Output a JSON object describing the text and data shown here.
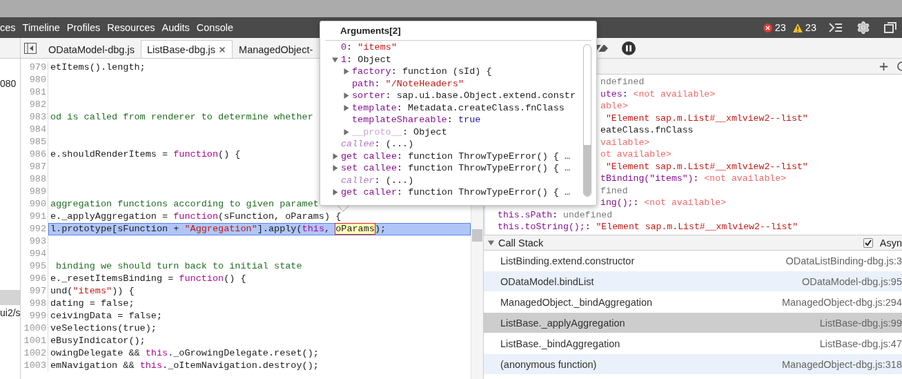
{
  "top_toolbar": {
    "tabs": [
      {
        "label": "ces"
      },
      {
        "label": "Timeline"
      },
      {
        "label": "Profiles"
      },
      {
        "label": "Resources"
      },
      {
        "label": "Audits"
      },
      {
        "label": "Console"
      }
    ],
    "error_count": "23",
    "warning_count": "23"
  },
  "navigator": {
    "items": [
      {
        "label": "080",
        "selected": false
      },
      {
        "selected": true
      },
      {
        "label": "ui2/s",
        "selected": false
      }
    ]
  },
  "editor": {
    "tabs": [
      {
        "label": "ODataModel-dbg.js",
        "selected": false
      },
      {
        "label": "ListBase-dbg.js",
        "selected": true
      },
      {
        "label": "ManagedObject-",
        "selected": false
      }
    ],
    "lines": [
      {
        "number": "979",
        "selected": false,
        "segments": [
          {
            "text": "etItems().length;",
            "kind": "plain"
          }
        ]
      },
      {
        "number": "980",
        "selected": false
      },
      {
        "number": "981",
        "selected": false
      },
      {
        "number": "982",
        "selected": false
      },
      {
        "number": "983",
        "selected": false,
        "segments": [
          {
            "text": "od is called from renderer to determine whether",
            "kind": "comment"
          }
        ]
      },
      {
        "number": "984",
        "selected": false
      },
      {
        "number": "985",
        "selected": false
      },
      {
        "number": "986",
        "selected": false,
        "segments": [
          {
            "text": "e.shouldRenderItems = ",
            "kind": "plain"
          },
          {
            "text": "function",
            "kind": "keyword"
          },
          {
            "text": "() {",
            "kind": "plain"
          }
        ]
      },
      {
        "number": "987",
        "selected": false
      },
      {
        "number": "988",
        "selected": false
      },
      {
        "number": "989",
        "selected": false
      },
      {
        "number": "990",
        "selected": false,
        "segments": [
          {
            "text": "aggregation functions according to given paramet",
            "kind": "comment"
          }
        ]
      },
      {
        "number": "991",
        "selected": false,
        "segments": [
          {
            "text": "e._applyAggregation = ",
            "kind": "plain"
          },
          {
            "text": "function",
            "kind": "keyword"
          },
          {
            "text": "(sFunction, oParams) {",
            "kind": "plain"
          }
        ]
      },
      {
        "number": "992",
        "selected": true,
        "segments": [
          {
            "text": "l.prototype[sFunction + ",
            "kind": "plain"
          },
          {
            "text": "\"Aggregation\"",
            "kind": "string"
          },
          {
            "text": "].apply(",
            "kind": "plain"
          },
          {
            "text": "this",
            "kind": "keyword"
          },
          {
            "text": ", ",
            "kind": "plain"
          },
          {
            "text": "oParams",
            "kind": "highlight"
          },
          {
            "text": ");",
            "kind": "plain"
          }
        ]
      },
      {
        "number": "993",
        "selected": false
      },
      {
        "number": "994",
        "selected": false
      },
      {
        "number": "995",
        "selected": false,
        "segments": [
          {
            "text": " binding we should turn back to initial state",
            "kind": "comment"
          }
        ]
      },
      {
        "number": "996",
        "selected": false,
        "segments": [
          {
            "text": "e._resetItemsBinding = ",
            "kind": "plain"
          },
          {
            "text": "function",
            "kind": "keyword"
          },
          {
            "text": "() {",
            "kind": "plain"
          }
        ]
      },
      {
        "number": "997",
        "selected": false,
        "segments": [
          {
            "text": "und(",
            "kind": "plain"
          },
          {
            "text": "\"items\"",
            "kind": "string"
          },
          {
            "text": ")) {",
            "kind": "plain"
          }
        ]
      },
      {
        "number": "998",
        "selected": false,
        "segments": [
          {
            "text": "dating = false;",
            "kind": "plain"
          }
        ]
      },
      {
        "number": "999",
        "selected": false,
        "segments": [
          {
            "text": "ceivingData = false;",
            "kind": "plain"
          }
        ]
      },
      {
        "number": "1000",
        "selected": false,
        "segments": [
          {
            "text": "veSelections(true);",
            "kind": "plain"
          }
        ]
      },
      {
        "number": "1001",
        "selected": false,
        "segments": [
          {
            "text": "eBusyIndicator();",
            "kind": "plain"
          }
        ]
      },
      {
        "number": "1002",
        "selected": false,
        "segments": [
          {
            "text": "owingDelegate && ",
            "kind": "plain"
          },
          {
            "text": "this",
            "kind": "keyword"
          },
          {
            "text": "._oGrowingDelegate.reset();",
            "kind": "plain"
          }
        ]
      },
      {
        "number": "1003",
        "selected": false,
        "segments": [
          {
            "text": "emNavigation && ",
            "kind": "plain"
          },
          {
            "text": "this",
            "kind": "keyword"
          },
          {
            "text": "._oItemNavigation.destroy();",
            "kind": "plain"
          }
        ]
      }
    ]
  },
  "arguments_popover": {
    "title": "Arguments[2]",
    "nodes": [
      {
        "parts": [
          {
            "text": "0",
            "kind": "key"
          },
          {
            "text": ": ",
            "kind": "plain"
          },
          {
            "text": "\"items\"",
            "kind": "string"
          }
        ]
      },
      {
        "expanded": true,
        "parts": [
          {
            "text": "1",
            "kind": "key"
          },
          {
            "text": ": Object",
            "kind": "plain"
          }
        ],
        "children": [
          {
            "expanded": false,
            "parts": [
              {
                "text": "factory",
                "kind": "key"
              },
              {
                "text": ": function (sId) {",
                "kind": "plain"
              }
            ]
          },
          {
            "parts": [
              {
                "text": "path",
                "kind": "key"
              },
              {
                "text": ": ",
                "kind": "plain"
              },
              {
                "text": "\"/NoteHeaders\"",
                "kind": "string"
              }
            ]
          },
          {
            "expanded": false,
            "parts": [
              {
                "text": "sorter",
                "kind": "key"
              },
              {
                "text": ": sap.ui.base.Object.extend.constr",
                "kind": "plain"
              }
            ]
          },
          {
            "expanded": false,
            "parts": [
              {
                "text": "template",
                "kind": "key"
              },
              {
                "text": ": Metadata.createClass.fnClass",
                "kind": "plain"
              }
            ]
          },
          {
            "parts": [
              {
                "text": "templateShareable",
                "kind": "key"
              },
              {
                "text": ": ",
                "kind": "plain"
              },
              {
                "text": "true",
                "kind": "bool"
              }
            ]
          },
          {
            "expanded": false,
            "parts": [
              {
                "text": "__proto__",
                "kind": "faded"
              },
              {
                "text": ": Object",
                "kind": "plain"
              }
            ]
          }
        ]
      },
      {
        "parts": [
          {
            "text": "callee",
            "kind": "lazy"
          },
          {
            "text": ": (...)",
            "kind": "plain"
          }
        ]
      },
      {
        "expanded": false,
        "parts": [
          {
            "text": "get callee",
            "kind": "key"
          },
          {
            "text": ": function ThrowTypeError() { …",
            "kind": "plain"
          }
        ]
      },
      {
        "expanded": false,
        "parts": [
          {
            "text": "set callee",
            "kind": "key"
          },
          {
            "text": ": function ThrowTypeError() { …",
            "kind": "plain"
          }
        ]
      },
      {
        "parts": [
          {
            "text": "caller",
            "kind": "lazy"
          },
          {
            "text": ": (...)",
            "kind": "plain"
          }
        ]
      },
      {
        "expanded": false,
        "parts": [
          {
            "text": "get caller",
            "kind": "key"
          },
          {
            "text": ": function ThrowTypeError() { …",
            "kind": "plain"
          }
        ]
      }
    ]
  },
  "watch": {
    "rows": [
      {
        "kind": "partial",
        "segments": [
          {
            "text": "ndefined",
            "kind": "undef"
          }
        ]
      },
      {
        "kind": "partial",
        "segments": [
          {
            "text": "utes",
            "kind": "name"
          },
          {
            "text": ": ",
            "kind": "plain"
          },
          {
            "text": "<not available>",
            "kind": "na"
          }
        ]
      },
      {
        "kind": "partial",
        "segments": [
          {
            "text": "able>",
            "kind": "na"
          }
        ]
      },
      {
        "kind": "partial",
        "segments": [
          {
            "text": " \"Element sap.m.List#__xmlview2--list\"",
            "kind": "string"
          }
        ]
      },
      {
        "kind": "partial",
        "segments": [
          {
            "text": "eateClass.fnClass",
            "kind": "plain"
          }
        ]
      },
      {
        "kind": "partial",
        "segments": [
          {
            "text": "vailable>",
            "kind": "na"
          }
        ]
      },
      {
        "kind": "partial",
        "segments": [
          {
            "text": "ot available>",
            "kind": "na"
          }
        ]
      },
      {
        "kind": "partial",
        "segments": [
          {
            "text": " \"Element sap.m.List#__xmlview2--list\"",
            "kind": "string"
          }
        ]
      },
      {
        "kind": "partial",
        "segments": [
          {
            "text": "tBinding(\"items\")",
            "kind": "name"
          },
          {
            "text": ": ",
            "kind": "plain"
          },
          {
            "text": "<not available>",
            "kind": "na"
          }
        ]
      },
      {
        "kind": "partial",
        "segments": [
          {
            "text": "fined",
            "kind": "undef"
          }
        ]
      },
      {
        "kind": "partial",
        "segments": [
          {
            "text": "ing();",
            "kind": "name"
          },
          {
            "text": ": ",
            "kind": "plain"
          },
          {
            "text": "<not available>",
            "kind": "na"
          }
        ]
      },
      {
        "kind": "full",
        "segments": [
          {
            "text": "this.sPath",
            "kind": "name"
          },
          {
            "text": ": ",
            "kind": "plain"
          },
          {
            "text": "undefined",
            "kind": "undef"
          }
        ]
      },
      {
        "kind": "full",
        "segments": [
          {
            "text": "this.toString();",
            "kind": "name"
          },
          {
            "text": ": ",
            "kind": "plain"
          },
          {
            "text": "\"Element sap.m.List#__xmlview2--list\"",
            "kind": "string"
          }
        ]
      }
    ]
  },
  "call_stack": {
    "title": "Call Stack",
    "expanded": true,
    "async": {
      "label": "Asyn",
      "checked": true
    },
    "frames": [
      {
        "function": "ListBinding.extend.constructor",
        "location": "ODataListBinding-dbg.js:3",
        "selected": false
      },
      {
        "function": "ODataModel.bindList",
        "location": "ODataModel-dbg.js:95",
        "selected": false
      },
      {
        "function": "ManagedObject._bindAggregation",
        "location": "ManagedObject-dbg.js:294",
        "selected": false
      },
      {
        "function": "ListBase._applyAggregation",
        "location": "ListBase-dbg.js:99",
        "selected": true
      },
      {
        "function": "ListBase._bindAggregation",
        "location": "ListBase-dbg.js:47",
        "selected": false
      },
      {
        "function": "(anonymous function)",
        "location": "ManagedObject-dbg.js:318",
        "selected": false
      }
    ]
  }
}
